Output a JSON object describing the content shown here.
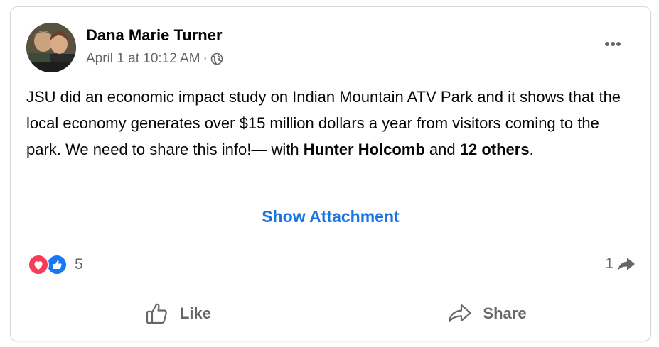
{
  "post": {
    "author": "Dana Marie Turner",
    "timestamp": "April 1 at 10:12 AM",
    "separator": "·",
    "privacy_icon": "globe-icon",
    "text_main": "JSU did an economic impact study on Indian Mountain ATV Park and it shows that the local economy generates over $15 million dollars a year from visitors coming to the park. We need to share this info!— with ",
    "tagged_person": "Hunter Holcomb",
    "tag_joiner": " and ",
    "tagged_others": "12 others",
    "tag_end": ".",
    "attachment_link": "Show Attachment"
  },
  "stats": {
    "reaction_icons": [
      "heart-icon",
      "like-icon"
    ],
    "reaction_count": "5",
    "share_count": "1"
  },
  "actions": {
    "like_label": "Like",
    "share_label": "Share"
  },
  "colors": {
    "link": "#1b74e4",
    "secondary_text": "#65676b",
    "heart": "#f33e58",
    "like": "#1877f2"
  }
}
